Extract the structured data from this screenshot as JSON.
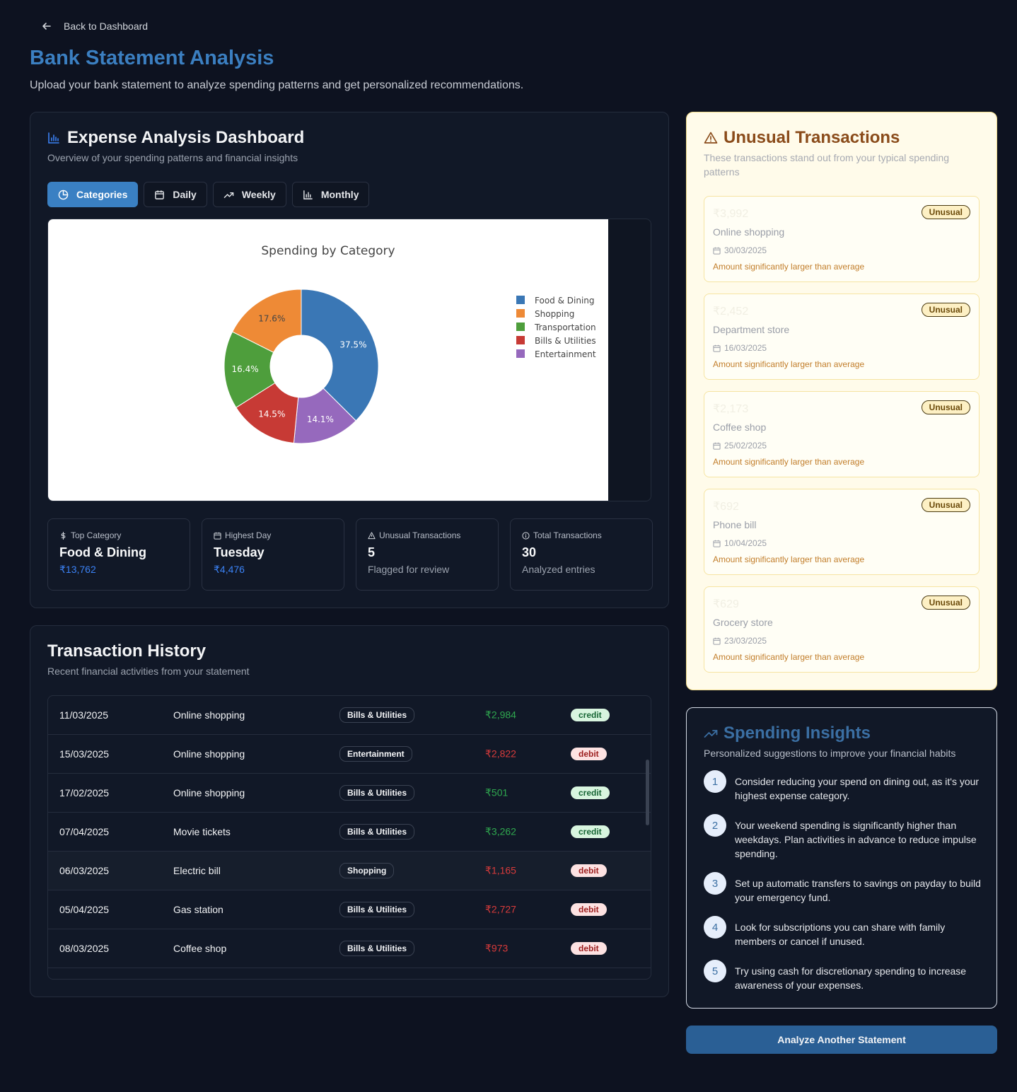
{
  "nav": {
    "back_label": "Back to Dashboard"
  },
  "page": {
    "title": "Bank Statement Analysis",
    "subtitle": "Upload your bank statement to analyze spending patterns and get personalized recommendations."
  },
  "dashboard": {
    "title": "Expense Analysis Dashboard",
    "subtitle": "Overview of your spending patterns and financial insights",
    "tabs": [
      {
        "label": "Categories",
        "icon": "pie-chart-icon",
        "active": true
      },
      {
        "label": "Daily",
        "icon": "calendar-icon",
        "active": false
      },
      {
        "label": "Weekly",
        "icon": "trending-up-icon",
        "active": false
      },
      {
        "label": "Monthly",
        "icon": "bar-chart-icon",
        "active": false
      }
    ],
    "stats": [
      {
        "label": "Top Category",
        "icon": "dollar-icon",
        "value": "Food & Dining",
        "sub": "₹13,762"
      },
      {
        "label": "Highest Day",
        "icon": "calendar-icon",
        "value": "Tuesday",
        "sub": "₹4,476"
      },
      {
        "label": "Unusual Transactions",
        "icon": "alert-triangle-icon",
        "value": "5",
        "sub": "Flagged for review"
      },
      {
        "label": "Total Transactions",
        "icon": "info-icon",
        "value": "30",
        "sub": "Analyzed entries"
      }
    ]
  },
  "chart_data": {
    "type": "pie",
    "title": "Spending by Category",
    "hole": true,
    "categories": [
      "Food & Dining",
      "Shopping",
      "Transportation",
      "Bills & Utilities",
      "Entertainment"
    ],
    "values": [
      37.5,
      17.6,
      16.4,
      14.5,
      14.1
    ],
    "value_labels": [
      "37.5%",
      "17.6%",
      "16.4%",
      "14.5%",
      "14.1%"
    ],
    "colors": [
      "#3a77b5",
      "#ee8a36",
      "#4e9e3c",
      "#c73a35",
      "#9669bd"
    ],
    "slice_order_clockwise_from_top": [
      "Food & Dining",
      "Entertainment",
      "Bills & Utilities",
      "Transportation",
      "Shopping"
    ],
    "legend": "right"
  },
  "history": {
    "title": "Transaction History",
    "subtitle": "Recent financial activities from your statement",
    "rows": [
      {
        "date": "11/03/2025",
        "desc": "Online shopping",
        "category": "Bills & Utilities",
        "amount": "₹2,984",
        "type": "credit"
      },
      {
        "date": "15/03/2025",
        "desc": "Online shopping",
        "category": "Entertainment",
        "amount": "₹2,822",
        "type": "debit"
      },
      {
        "date": "17/02/2025",
        "desc": "Online shopping",
        "category": "Bills & Utilities",
        "amount": "₹501",
        "type": "credit"
      },
      {
        "date": "07/04/2025",
        "desc": "Movie tickets",
        "category": "Bills & Utilities",
        "amount": "₹3,262",
        "type": "credit"
      },
      {
        "date": "06/03/2025",
        "desc": "Electric bill",
        "category": "Shopping",
        "amount": "₹1,165",
        "type": "debit"
      },
      {
        "date": "05/04/2025",
        "desc": "Gas station",
        "category": "Bills & Utilities",
        "amount": "₹2,727",
        "type": "debit"
      },
      {
        "date": "08/03/2025",
        "desc": "Coffee shop",
        "category": "Bills & Utilities",
        "amount": "₹973",
        "type": "debit"
      }
    ]
  },
  "unusual": {
    "title": "Unusual Transactions",
    "subtitle": "These transactions stand out from your typical spending patterns",
    "badge": "Unusual",
    "items": [
      {
        "amount": "₹3,992",
        "desc": "Online shopping",
        "date": "30/03/2025",
        "note": "Amount significantly larger than average"
      },
      {
        "amount": "₹2,452",
        "desc": "Department store",
        "date": "16/03/2025",
        "note": "Amount significantly larger than average"
      },
      {
        "amount": "₹2,173",
        "desc": "Coffee shop",
        "date": "25/02/2025",
        "note": "Amount significantly larger than average"
      },
      {
        "amount": "₹692",
        "desc": "Phone bill",
        "date": "10/04/2025",
        "note": "Amount significantly larger than average"
      },
      {
        "amount": "₹629",
        "desc": "Grocery store",
        "date": "23/03/2025",
        "note": "Amount significantly larger than average"
      }
    ]
  },
  "insights": {
    "title": "Spending Insights",
    "subtitle": "Personalized suggestions to improve your financial habits",
    "tips": [
      {
        "num": "1",
        "text": "Consider reducing your spend on dining out, as it's your highest expense category."
      },
      {
        "num": "2",
        "text": "Your weekend spending is significantly higher than weekdays. Plan activities in advance to reduce impulse spending."
      },
      {
        "num": "3",
        "text": "Set up automatic transfers to savings on payday to build your emergency fund."
      },
      {
        "num": "4",
        "text": "Look for subscriptions you can share with family members or cancel if unused."
      },
      {
        "num": "5",
        "text": "Try using cash for discretionary spending to increase awareness of your expenses."
      }
    ]
  },
  "actions": {
    "analyze_label": "Analyze Another Statement"
  }
}
